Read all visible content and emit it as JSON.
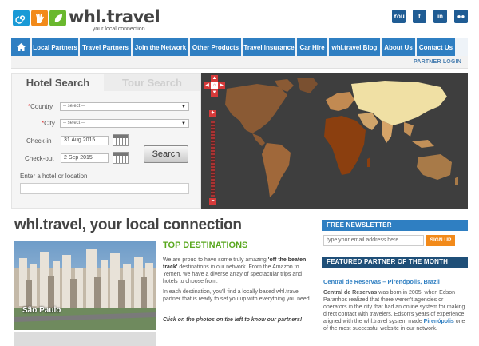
{
  "brand": {
    "name": "whl.travel",
    "tagline": "...your local connection",
    "colors": {
      "blue": "#2f7fc2",
      "orange": "#f28a1a",
      "green": "#6ab82e"
    }
  },
  "social": [
    {
      "label": "You",
      "icon": "youtube-icon"
    },
    {
      "label": "t",
      "icon": "twitter-icon"
    },
    {
      "label": "in",
      "icon": "linkedin-icon"
    },
    {
      "label": "●●",
      "icon": "flickr-icon"
    }
  ],
  "nav": {
    "items": [
      "Local Partners",
      "Travel Partners",
      "Join the Network",
      "Other Products",
      "Travel Insurance",
      "Car Hire",
      "whl.travel Blog",
      "About Us",
      "Contact Us"
    ],
    "partner_login": "PARTNER LOGIN"
  },
  "search": {
    "tabs": {
      "hotel": "Hotel Search",
      "tour": "Tour Search"
    },
    "country_label": "Country",
    "city_label": "City",
    "select_placeholder": "-- select --",
    "checkin_label": "Check-in",
    "checkin_value": "31 Aug 2015",
    "checkout_label": "Check-out",
    "checkout_value": "2 Sep 2015",
    "search_button": "Search",
    "hotel_label": "Enter a hotel or location"
  },
  "main": {
    "heading": "whl.travel, your local connection",
    "photo_caption": "São Paulo",
    "top_destinations": "TOP DESTINATIONS",
    "p1_start": "We are proud to have some truly amazing ",
    "p1_bold": "'off the beaten track'",
    "p1_end": " destinations in our network. From the Amazon to Yemen, we have a diverse array of spectacular trips and hotels to choose from.",
    "p2": "In each destination, you'll find a locally based whl.travel partner that is ready to set you up with everything you need.",
    "p3": "Click on the photos on the left to know our partners!"
  },
  "newsletter": {
    "title": "FREE NEWSLETTER",
    "placeholder": "type your email address here",
    "button": "SIGN UP"
  },
  "featured": {
    "title": "FEATURED PARTNER OF THE MONTH",
    "link": "Central de Reservas – Pirenópolis, Brazil",
    "name": "Central de Reservas",
    "text1": " was born in 2005, when Edson Paranhos realized that there weren't agencies or operators in the city that had an online system for making direct contact with travelers. Edson's years of experience aligned with the whl.travel system made ",
    "city": "Pirenópolis",
    "text2": " one of the most successful website in our network."
  }
}
